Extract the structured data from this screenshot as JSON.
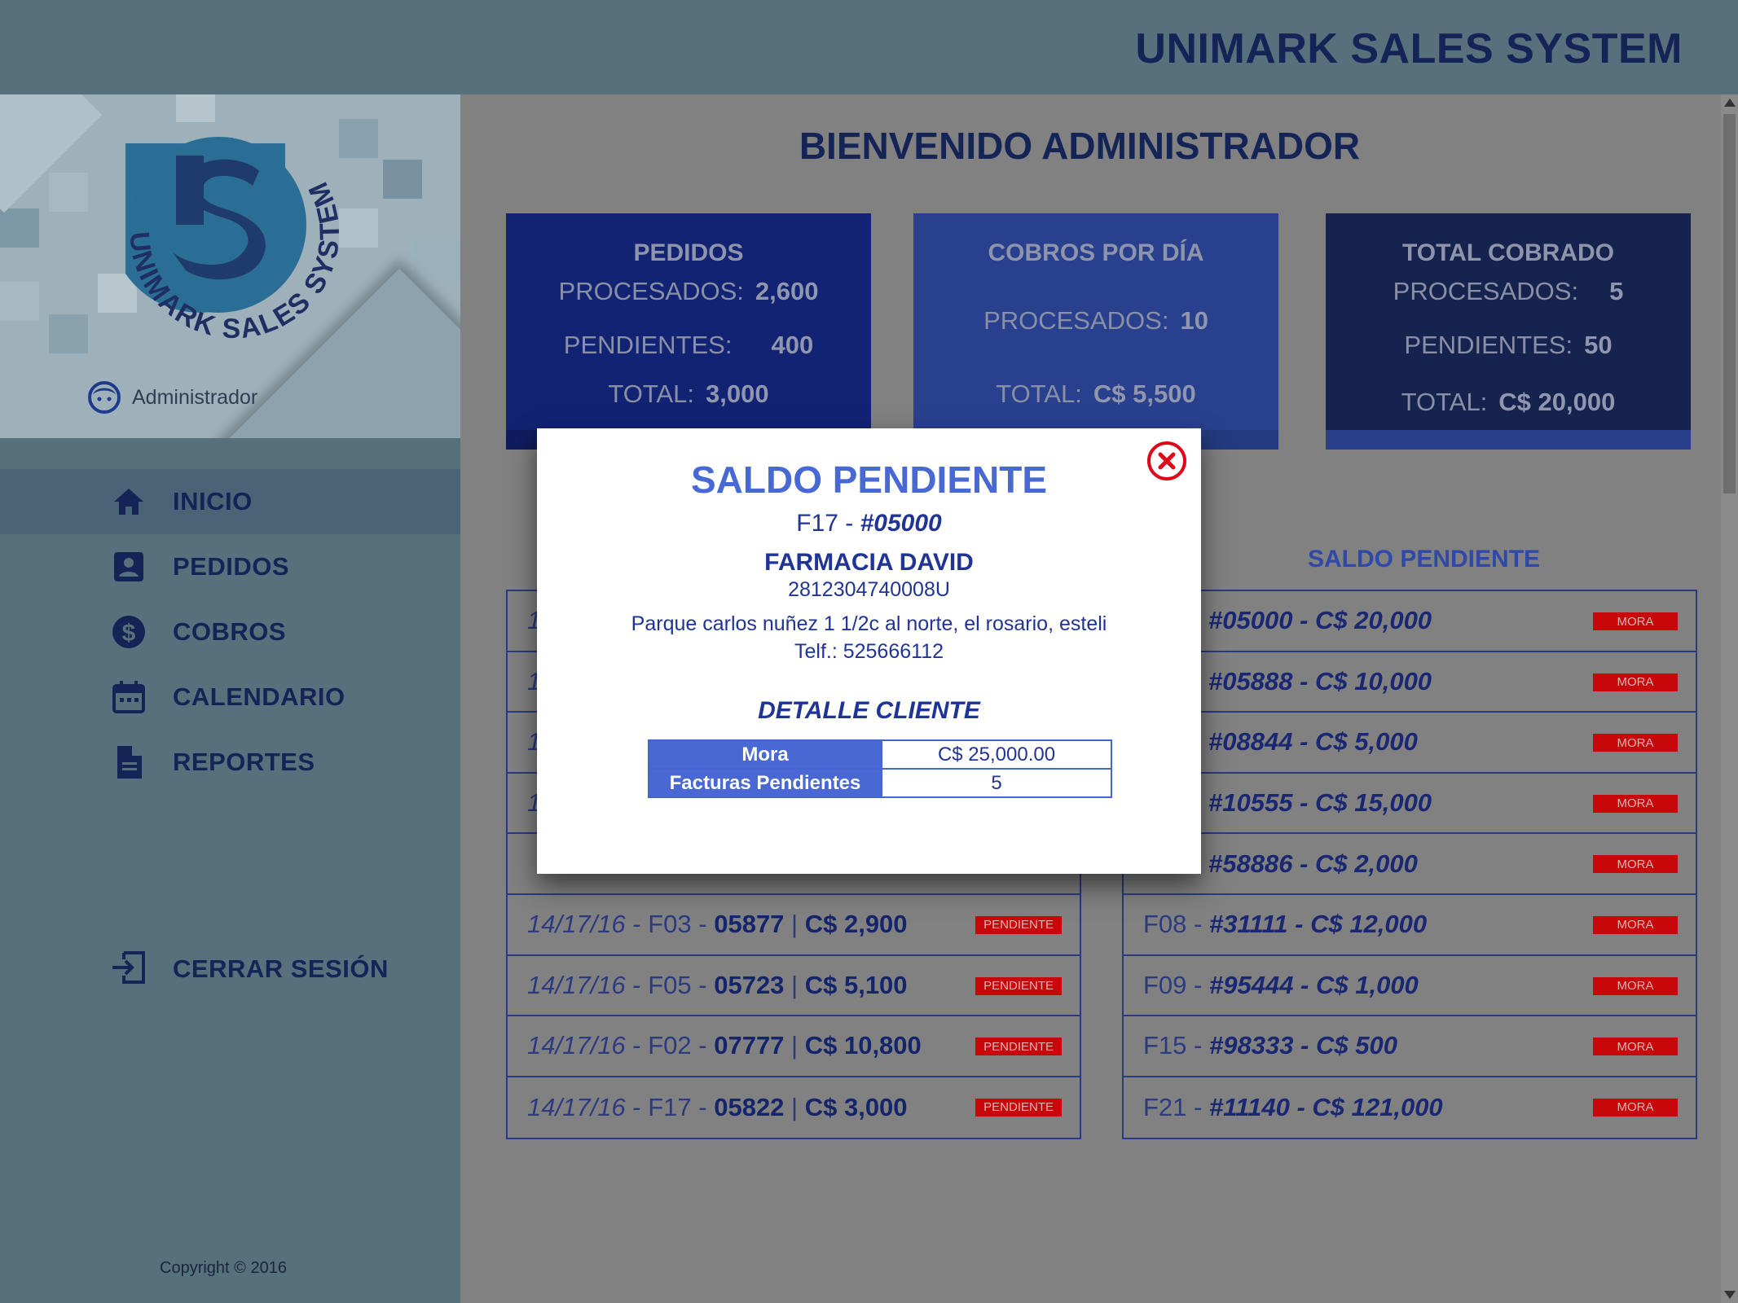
{
  "header": {
    "title": "UNIMARK SALES SYSTEM"
  },
  "sidebar": {
    "logo_text": "UNIMARK SALES SYSTEM",
    "user": {
      "name": "Administrador",
      "icon": "user-face-icon"
    },
    "nav": [
      {
        "label": "INICIO",
        "icon": "home-icon",
        "active": true
      },
      {
        "label": "PEDIDOS",
        "icon": "contact-card-icon",
        "active": false
      },
      {
        "label": "COBROS",
        "icon": "dollar-circle-icon",
        "active": false
      },
      {
        "label": "CALENDARIO",
        "icon": "calendar-icon",
        "active": false
      },
      {
        "label": "REPORTES",
        "icon": "document-icon",
        "active": false
      }
    ],
    "logout": {
      "label": "CERRAR SESIÓN",
      "icon": "exit-icon"
    },
    "copyright": "Copyright © 2016"
  },
  "main": {
    "welcome": "BIENVENIDO ADMINISTRADOR",
    "cards": [
      {
        "title": "PEDIDOS",
        "rows": [
          {
            "label": "PROCESADOS:",
            "value": "2,600"
          },
          {
            "label": "PENDIENTES:",
            "value": "400"
          },
          {
            "label": "TOTAL:",
            "value": "3,000"
          }
        ]
      },
      {
        "title": "COBROS POR DÍA",
        "rows": [
          {
            "label": "PROCESADOS:",
            "value": "10"
          },
          {
            "label": "TOTAL:",
            "value": "C$ 5,500"
          }
        ]
      },
      {
        "title": "TOTAL COBRADO",
        "rows": [
          {
            "label": "PROCESADOS:",
            "value": "5"
          },
          {
            "label": "PENDIENTES:",
            "value": "50"
          },
          {
            "label": "TOTAL:",
            "value": "C$ 20,000"
          }
        ]
      }
    ],
    "right_list_title": "SALDO PENDIENTE",
    "left_list": [
      {
        "date": "",
        "code": "",
        "number": "",
        "amount": "",
        "tag": ""
      },
      {
        "date": "",
        "code": "",
        "number": "",
        "amount": "",
        "tag": ""
      },
      {
        "date": "",
        "code": "",
        "number": "",
        "amount": "",
        "tag": ""
      },
      {
        "date": "",
        "code": "",
        "number": "",
        "amount": "",
        "tag": ""
      },
      {
        "date": "",
        "code": "",
        "number": "",
        "amount": "",
        "tag": ""
      },
      {
        "date": "14/17/16",
        "code": "F03",
        "number": "05877",
        "amount": "C$ 2,900",
        "tag": "PENDIENTE"
      },
      {
        "date": "14/17/16",
        "code": "F05",
        "number": "05723",
        "amount": "C$ 5,100",
        "tag": "PENDIENTE"
      },
      {
        "date": "14/17/16",
        "code": "F02",
        "number": "07777",
        "amount": "C$ 10,800",
        "tag": "PENDIENTE"
      },
      {
        "date": "14/17/16",
        "code": "F17",
        "number": "05822",
        "amount": "C$ 3,000",
        "tag": "PENDIENTE"
      }
    ],
    "right_list": [
      {
        "code": "",
        "entry": "#05000 - C$ 20,000",
        "tag": "MORA"
      },
      {
        "code": "",
        "entry": "#05888 - C$ 10,000",
        "tag": "MORA"
      },
      {
        "code": "",
        "entry": "#08844 - C$ 5,000",
        "tag": "MORA"
      },
      {
        "code": "",
        "entry": "#10555 - C$ 15,000",
        "tag": "MORA"
      },
      {
        "code": "",
        "entry": "#58886 - C$ 2,000",
        "tag": "MORA"
      },
      {
        "code": "F08",
        "entry": "#31111 - C$ 12,000",
        "tag": "MORA"
      },
      {
        "code": "F09",
        "entry": "#95444 - C$ 1,000",
        "tag": "MORA"
      },
      {
        "code": "F15",
        "entry": "#98333 - C$ 500",
        "tag": "MORA"
      },
      {
        "code": "F21",
        "entry": "#11140 - C$ 121,000",
        "tag": "MORA"
      }
    ]
  },
  "modal": {
    "title": "SALDO PENDIENTE",
    "invoice_code": "F17",
    "invoice_number": "#05000",
    "client_name": "FARMACIA DAVID",
    "client_id": "2812304740008U",
    "address": "Parque carlos nuñez 1 1/2c al norte, el rosario, esteli",
    "phone": "Telf.: 525666112",
    "detail_title": "DETALLE CLIENTE",
    "detail": [
      {
        "label": "Mora",
        "value": "C$ 25,000.00"
      },
      {
        "label": "Facturas Pendientes",
        "value": "5"
      }
    ],
    "close_icon": "close-circle-icon"
  },
  "colors": {
    "header_bg": "#56707c",
    "title_navy": "#142456",
    "card_1": "#122373",
    "card_2": "#29408f",
    "card_3": "#17234f",
    "modal_blue": "#4868d3",
    "tag_red": "#c8070b",
    "overlay": "#818181"
  }
}
